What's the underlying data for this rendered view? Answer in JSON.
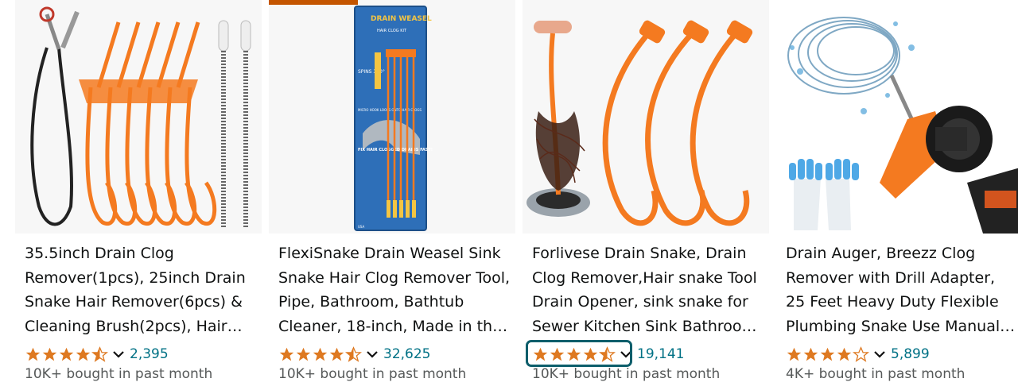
{
  "products": [
    {
      "title": "35.5inch Drain Clog Remover(1pcs), 25inch Drain Snake Hair Remover(6pcs)  & Cleaning Brush(2pcs), Hair Catcher",
      "rating": 4.5,
      "ratings_count": "2,395",
      "bought": "10K+ bought in past month"
    },
    {
      "title": "FlexiSnake Drain Weasel Sink Snake Hair Clog Remover Tool, Pipe, Bathroom, Bathtub Cleaner, 18-inch, Made in the USA",
      "rating": 4.5,
      "ratings_count": "32,625",
      "bought": "10K+ bought in past month",
      "package_text": {
        "brand": "DRAIN WEASEL",
        "subtitle": "HAIR CLOG KIT",
        "spins": "SPINS 360°",
        "note": "MICRO HOOK LOOPS ONTO HAIR CLOGS",
        "callout": "FIX HAIR CLOGGED DRAINS FAST!",
        "footer": "USA"
      }
    },
    {
      "title": "Forlivese Drain Snake, Drain Clog Remover,Hair snake Tool Drain Opener, sink snake for Sewer Kitchen Sink Bathroom Tub",
      "rating": 4.5,
      "ratings_count": "19,141",
      "bought": "10K+ bought in past month"
    },
    {
      "title": "Drain Auger, Breezz Clog Remover with Drill Adapter, 25 Feet Heavy Duty Flexible Plumbing Snake Use Manually or with Drill",
      "rating": 4.0,
      "ratings_count": "5,899",
      "bought": "4K+ bought in past month"
    }
  ],
  "colors": {
    "star": "#de7921",
    "link": "#007185",
    "focus": "#0d5e6b",
    "product_orange": "#f47a20"
  },
  "icons": {
    "rating_dropdown": "chevron-down-icon",
    "star": "star-icon"
  }
}
